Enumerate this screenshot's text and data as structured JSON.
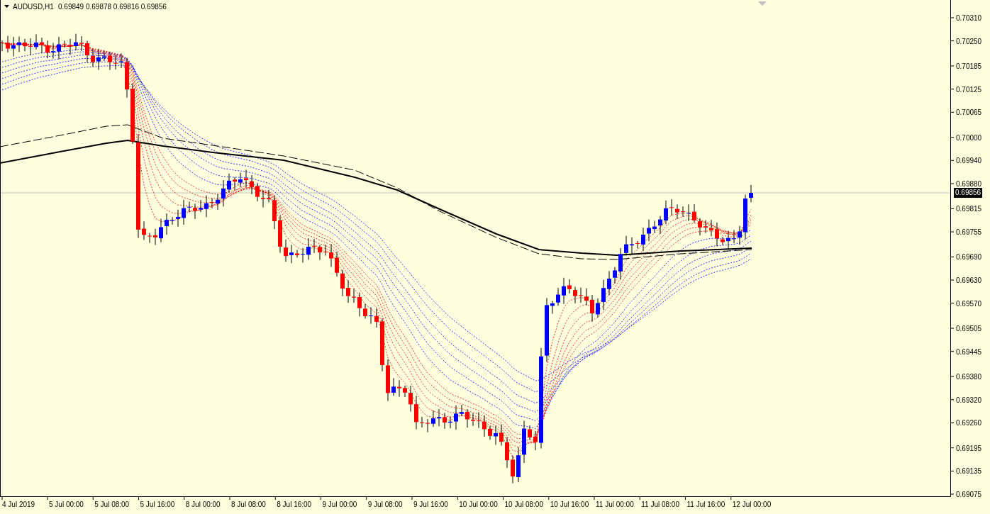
{
  "chart_header": {
    "symbol": "AUDUSD,H1",
    "quotes": [
      "0.69849",
      "0.69878",
      "0.69816",
      "0.69856"
    ]
  },
  "price_axis": {
    "ticks": [
      "0.70310",
      "0.70250",
      "0.70185",
      "0.70125",
      "0.70065",
      "0.70000",
      "0.69940",
      "0.69880",
      "0.69815",
      "0.69755",
      "0.69690",
      "0.69630",
      "0.69570",
      "0.69505",
      "0.69445",
      "0.69380",
      "0.69320",
      "0.69260",
      "0.69195",
      "0.69135",
      "0.69075"
    ],
    "current_price": "0.69856"
  },
  "time_axis": {
    "ticks": [
      "4 Jul 2019",
      "5 Jul 00:00",
      "5 Jul 08:00",
      "5 Jul 16:00",
      "8 Jul 00:00",
      "8 Jul 08:00",
      "8 Jul 16:00",
      "9 Jul 00:00",
      "9 Jul 08:00",
      "9 Jul 16:00",
      "10 Jul 00:00",
      "10 Jul 08:00",
      "10 Jul 16:00",
      "11 Jul 00:00",
      "11 Jul 08:00",
      "11 Jul 16:00",
      "12 Jul 00:00"
    ]
  }
}
